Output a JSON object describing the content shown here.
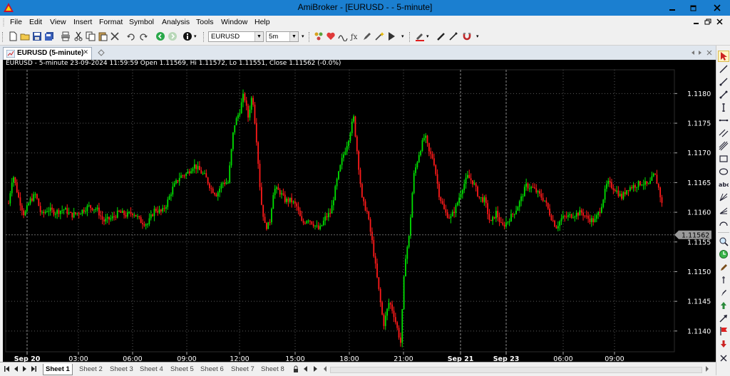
{
  "window": {
    "title": "AmiBroker - [EURUSD -  - 5-minute]"
  },
  "menu": [
    "File",
    "Edit",
    "View",
    "Insert",
    "Format",
    "Symbol",
    "Analysis",
    "Tools",
    "Window",
    "Help"
  ],
  "toolbar": {
    "symbol": "EURUSD",
    "interval": "5m"
  },
  "doc_tab": {
    "label": "EURUSD (5-minute)",
    "close": "✕"
  },
  "chart_info": "EURUSD - 5-minute 23-09-2024 11:59:59 Open 1.11569, Hi 1.11572, Lo 1.11551, Close 1.11562 (-0.0%)",
  "sheets": [
    "Sheet 1",
    "Sheet 2",
    "Sheet 3",
    "Sheet 4",
    "Sheet 5",
    "Sheet 6",
    "Sheet 7",
    "Sheet 8"
  ],
  "colors": {
    "bg": "#000000",
    "up": "#00e000",
    "down": "#ff1a1a",
    "grid": "#5a5a5a",
    "axis_text": "#ffffff"
  },
  "right_toolbar_icons": [
    "cursor-icon",
    "line-icon",
    "ray-icon",
    "segment-icon",
    "vertical-line-icon",
    "horizontal-line-icon",
    "channel-icon",
    "fibonacci-icon",
    "rectangle-icon",
    "ellipse-icon",
    "text-icon",
    "gann-icon",
    "arc-icon",
    "fan-icon",
    "zoom-icon",
    "timer-icon",
    "pencil-icon",
    "marker-icon",
    "arrow-icon"
  ],
  "chart_data": {
    "type": "candlestick",
    "symbol": "EURUSD",
    "interval": "5-minute",
    "ylim": [
      1.11365,
      1.1184
    ],
    "y_ticks": [
      "1.1180",
      "1.1175",
      "1.1170",
      "1.1165",
      "1.1160",
      "1.1155",
      "1.1150",
      "1.1145",
      "1.1140"
    ],
    "x_ticks": [
      "Sep 20",
      "03:00",
      "06:00",
      "09:00",
      "12:00",
      "15:00",
      "18:00",
      "21:00",
      "Sep 21",
      "Sep 23",
      "06:00",
      "09:00"
    ],
    "last_price_label": "1.11562",
    "price_path": [
      [
        0,
        1.11615
      ],
      [
        6,
        1.11665
      ],
      [
        14,
        1.11625
      ],
      [
        22,
        1.11595
      ],
      [
        30,
        1.1162
      ],
      [
        38,
        1.1163
      ],
      [
        46,
        1.11595
      ],
      [
        55,
        1.11605
      ],
      [
        65,
        1.116
      ],
      [
        78,
        1.11605
      ],
      [
        88,
        1.11595
      ],
      [
        100,
        1.116
      ],
      [
        112,
        1.1161
      ],
      [
        124,
        1.11605
      ],
      [
        133,
        1.11585
      ],
      [
        145,
        1.1159
      ],
      [
        155,
        1.116
      ],
      [
        165,
        1.11595
      ],
      [
        175,
        1.116
      ],
      [
        185,
        1.11585
      ],
      [
        195,
        1.1158
      ],
      [
        205,
        1.11605
      ],
      [
        215,
        1.116
      ],
      [
        222,
        1.11615
      ],
      [
        230,
        1.1164
      ],
      [
        240,
        1.1166
      ],
      [
        250,
        1.11665
      ],
      [
        260,
        1.1168
      ],
      [
        268,
        1.1167
      ],
      [
        276,
        1.1166
      ],
      [
        284,
        1.1164
      ],
      [
        292,
        1.1163
      ],
      [
        300,
        1.1165
      ],
      [
        308,
        1.1165
      ],
      [
        316,
        1.11745
      ],
      [
        324,
        1.1177
      ],
      [
        330,
        1.118
      ],
      [
        336,
        1.1176
      ],
      [
        342,
        1.118
      ],
      [
        348,
        1.1172
      ],
      [
        354,
        1.1162
      ],
      [
        360,
        1.11575
      ],
      [
        366,
        1.1158
      ],
      [
        372,
        1.1164
      ],
      [
        380,
        1.11635
      ],
      [
        388,
        1.1162
      ],
      [
        396,
        1.1162
      ],
      [
        404,
        1.1161
      ],
      [
        412,
        1.1158
      ],
      [
        420,
        1.1159
      ],
      [
        428,
        1.1158
      ],
      [
        436,
        1.1157
      ],
      [
        444,
        1.1159
      ],
      [
        452,
        1.116
      ],
      [
        460,
        1.1165
      ],
      [
        468,
        1.1169
      ],
      [
        476,
        1.1172
      ],
      [
        484,
        1.1176
      ],
      [
        490,
        1.1169
      ],
      [
        496,
        1.1162
      ],
      [
        503,
        1.116
      ],
      [
        510,
        1.1155
      ],
      [
        518,
        1.1148
      ],
      [
        526,
        1.1141
      ],
      [
        534,
        1.1145
      ],
      [
        540,
        1.1143
      ],
      [
        546,
        1.114
      ],
      [
        550,
        1.1138
      ],
      [
        556,
        1.1152
      ],
      [
        562,
        1.1156
      ],
      [
        568,
        1.1166
      ],
      [
        576,
        1.117
      ],
      [
        584,
        1.1173
      ],
      [
        590,
        1.117
      ],
      [
        596,
        1.1169
      ],
      [
        604,
        1.1163
      ],
      [
        612,
        1.116
      ],
      [
        620,
        1.1159
      ],
      [
        628,
        1.1161
      ],
      [
        636,
        1.1164
      ],
      [
        644,
        1.1166
      ],
      [
        652,
        1.1165
      ],
      [
        660,
        1.11625
      ],
      [
        668,
        1.1162
      ],
      [
        676,
        1.1158
      ],
      [
        684,
        1.116
      ],
      [
        692,
        1.11575
      ],
      [
        700,
        1.11585
      ],
      [
        712,
        1.11605
      ],
      [
        718,
        1.1162
      ],
      [
        726,
        1.11645
      ],
      [
        736,
        1.1164
      ],
      [
        744,
        1.1163
      ],
      [
        752,
        1.1162
      ],
      [
        760,
        1.11595
      ],
      [
        768,
        1.11575
      ],
      [
        776,
        1.1159
      ],
      [
        790,
        1.11595
      ],
      [
        804,
        1.116
      ],
      [
        812,
        1.1159
      ],
      [
        822,
        1.11585
      ],
      [
        830,
        1.11605
      ],
      [
        840,
        1.1165
      ],
      [
        850,
        1.1164
      ],
      [
        860,
        1.11625
      ],
      [
        868,
        1.1164
      ],
      [
        878,
        1.11645
      ],
      [
        888,
        1.1165
      ],
      [
        898,
        1.11645
      ],
      [
        906,
        1.11665
      ],
      [
        912,
        1.1164
      ],
      [
        918,
        1.11605
      ],
      [
        924,
        1.11575
      ],
      [
        926,
        1.11562
      ]
    ]
  }
}
